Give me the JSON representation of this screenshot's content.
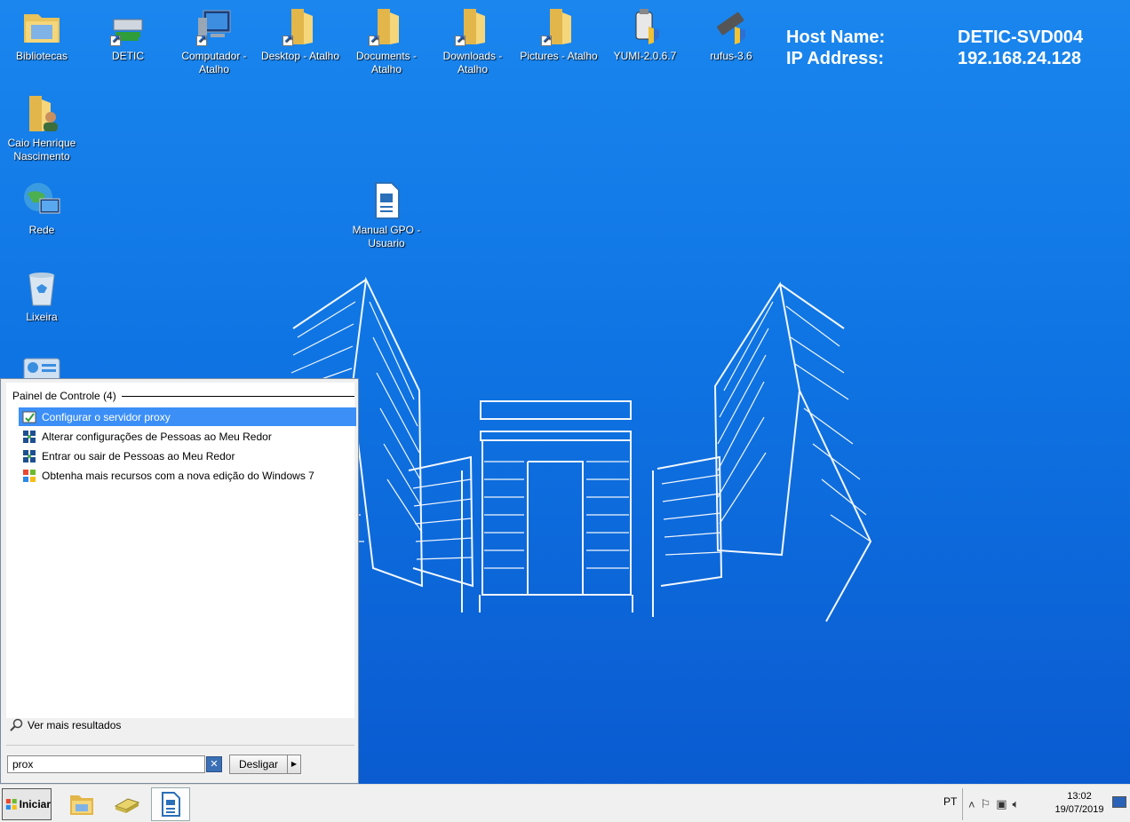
{
  "desktop": {
    "icons": [
      {
        "label": "Bibliotecas",
        "icon": "libraries-folder-icon"
      },
      {
        "label": "DETIC",
        "icon": "network-drive-icon"
      },
      {
        "label": "Computador - Atalho",
        "icon": "computer-icon"
      },
      {
        "label": "Desktop - Atalho",
        "icon": "folder-icon"
      },
      {
        "label": "Documents - Atalho",
        "icon": "folder-icon"
      },
      {
        "label": "Downloads - Atalho",
        "icon": "folder-icon"
      },
      {
        "label": "Pictures - Atalho",
        "icon": "folder-icon"
      },
      {
        "label": "YUMI-2.0.6.7",
        "icon": "usb-installer-icon"
      },
      {
        "label": "rufus-3.6",
        "icon": "usb-installer-icon"
      },
      {
        "label": "Caio Henrique Nascimento",
        "icon": "user-folder-icon"
      },
      {
        "label": "Rede",
        "icon": "network-globe-icon"
      },
      {
        "label": "Lixeira",
        "icon": "recycle-bin-icon"
      },
      {
        "label": "Manual GPO - Usuario",
        "icon": "document-icon"
      }
    ],
    "host_info": {
      "host_label": "Host Name:",
      "host_value": "DETIC-SVD004",
      "ip_label": "IP Address:",
      "ip_value": "192.168.24.128"
    }
  },
  "start_menu": {
    "group_title": "Painel de Controle (4)",
    "results": [
      {
        "label": "Configurar o servidor proxy",
        "selected": true
      },
      {
        "label": "Alterar configurações de Pessoas ao Meu Redor",
        "selected": false
      },
      {
        "label": "Entrar ou sair de Pessoas ao Meu Redor",
        "selected": false
      },
      {
        "label": "Obtenha mais recursos com a nova edição do Windows 7",
        "selected": false
      }
    ],
    "see_more": "Ver mais resultados",
    "search_value": "prox",
    "shutdown_label": "Desligar"
  },
  "taskbar": {
    "start_label": "Iniciar",
    "language": "PT",
    "time": "13:02",
    "date": "19/07/2019"
  },
  "colors": {
    "desktop_blue": "#1a86ee",
    "selection_blue": "#3b8ff6",
    "taskbar_bg": "#f0f0f0"
  }
}
